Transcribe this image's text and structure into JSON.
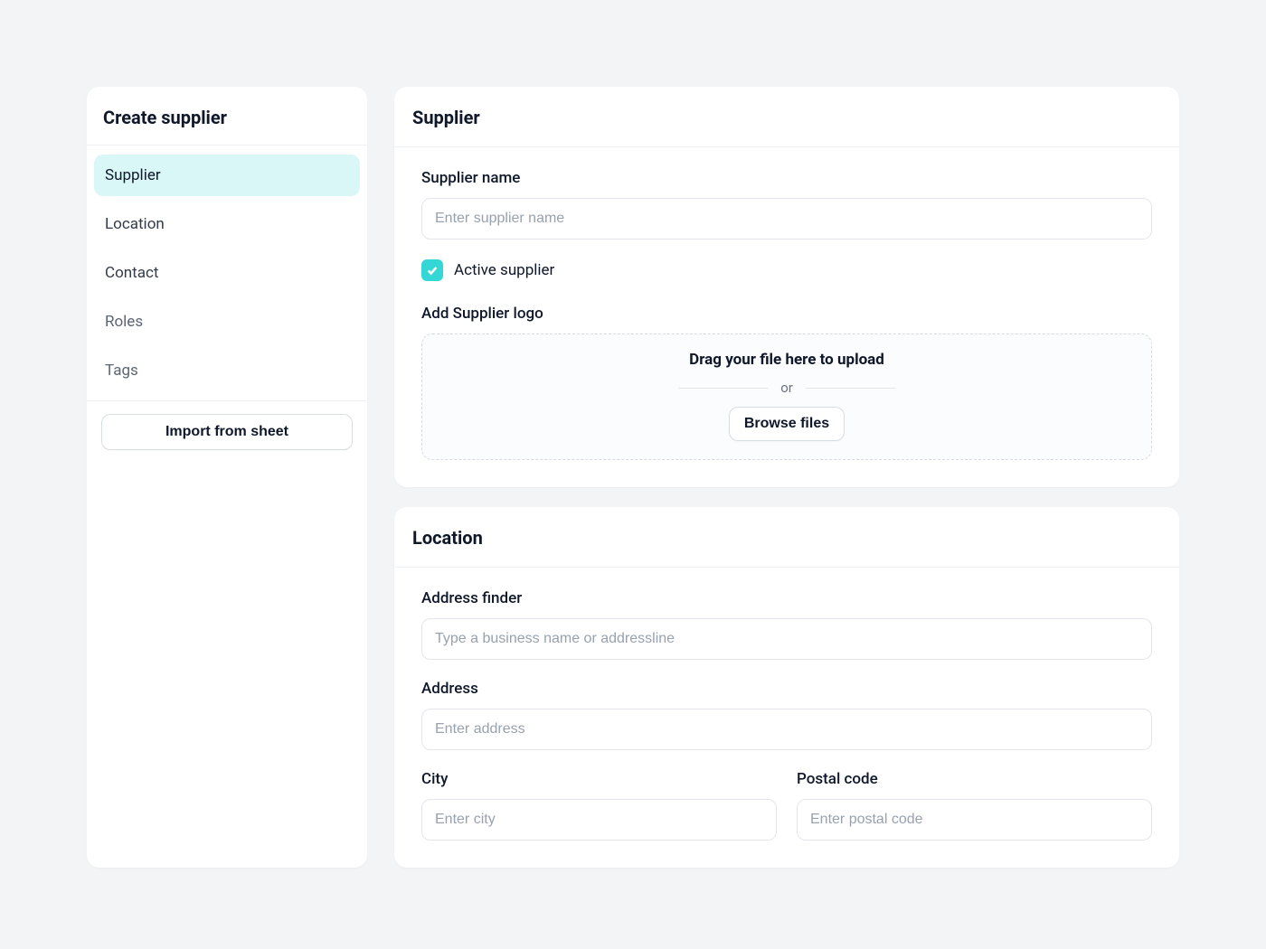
{
  "sidebar": {
    "title": "Create supplier",
    "items": [
      {
        "label": "Supplier",
        "active": true
      },
      {
        "label": "Location",
        "active": false
      },
      {
        "label": "Contact",
        "active": false
      },
      {
        "label": "Roles",
        "active": false
      },
      {
        "label": "Tags",
        "active": false
      }
    ],
    "import_button": "Import from sheet"
  },
  "supplier": {
    "section_title": "Supplier",
    "name_label": "Supplier name",
    "name_placeholder": "Enter supplier name",
    "active_checkbox_label": "Active supplier",
    "active_checked": true,
    "logo_label": "Add Supplier logo",
    "dropzone": {
      "drag_text": "Drag your file here to upload",
      "or_text": "or",
      "browse_button": "Browse files"
    }
  },
  "location": {
    "section_title": "Location",
    "address_finder_label": "Address finder",
    "address_finder_placeholder": "Type a business name or addressline",
    "address_label": "Address",
    "address_placeholder": "Enter address",
    "city_label": "City",
    "city_placeholder": "Enter city",
    "postal_label": "Postal code",
    "postal_placeholder": "Enter postal code"
  }
}
